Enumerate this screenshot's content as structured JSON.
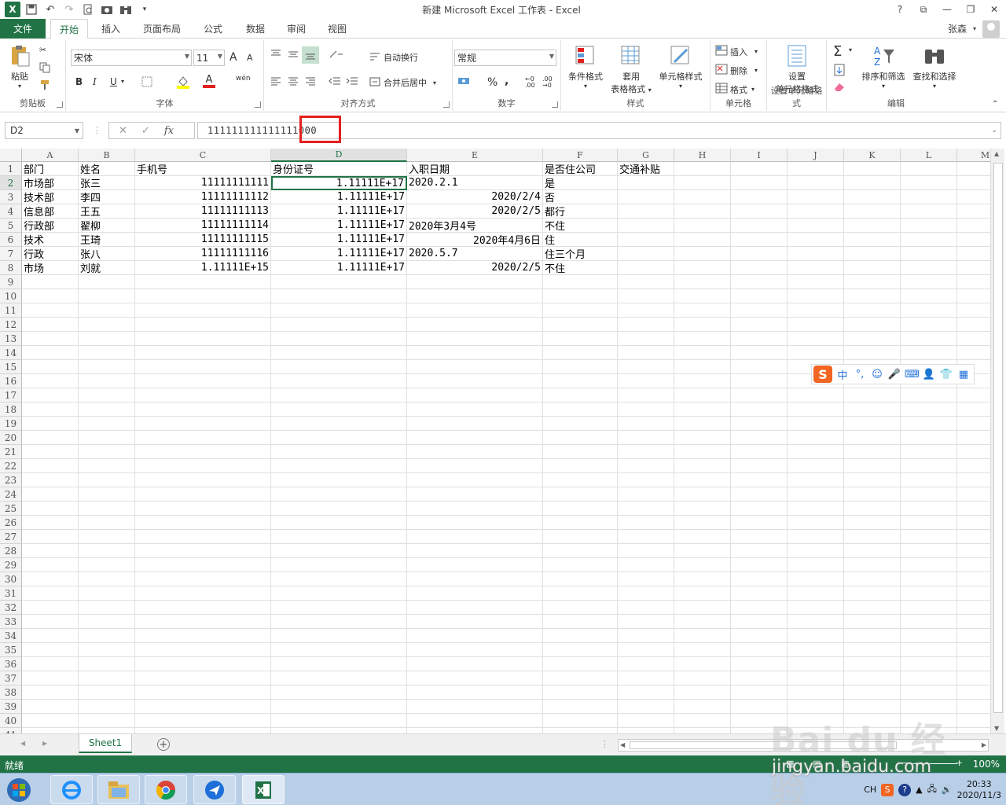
{
  "window": {
    "title": "新建 Microsoft Excel 工作表 - Excel",
    "help": "?",
    "controls": [
      "⧉",
      "—",
      "❐",
      "✕"
    ]
  },
  "tabs": {
    "file": "文件",
    "items": [
      "开始",
      "插入",
      "页面布局",
      "公式",
      "数据",
      "审阅",
      "视图"
    ],
    "active": "开始",
    "user": "张森"
  },
  "ribbon": {
    "clipboard": {
      "label": "剪贴板",
      "paste": "粘贴"
    },
    "font": {
      "label": "字体",
      "name": "宋体",
      "size": "11",
      "bold": "B",
      "italic": "I",
      "underline": "U",
      "grow": "A",
      "shrink": "A",
      "phonetic": "wén",
      "color_char": "A"
    },
    "alignment": {
      "label": "对齐方式",
      "wrap": "自动换行",
      "merge": "合并后居中"
    },
    "number": {
      "label": "数字",
      "format": "常规",
      "percent": "%",
      "comma": ","
    },
    "styles": {
      "label": "样式",
      "conditional": "条件格式",
      "table_line1": "套用",
      "table_line2": "表格格式",
      "cell_styles": "单元格样式"
    },
    "cells": {
      "label": "单元格",
      "insert": "插入",
      "delete": "删除",
      "format": "格式"
    },
    "setformat": {
      "label": "设置单元格格式",
      "line1": "设置",
      "line2": "单元格格式"
    },
    "editing": {
      "label": "编辑",
      "sum": "Σ",
      "sort": "排序和筛选",
      "find": "查找和选择"
    }
  },
  "formula_bar": {
    "name_box": "D2",
    "cancel": "✕",
    "enter": "✓",
    "fx": "fx",
    "value": "111111111111111000"
  },
  "columns": [
    "A",
    "B",
    "C",
    "D",
    "E",
    "F",
    "G",
    "H",
    "I",
    "J",
    "K",
    "L",
    "M"
  ],
  "selected_column": "D",
  "selected_row": 2,
  "rows": [
    [
      "部门",
      "姓名",
      "手机号",
      "身份证号",
      "入职日期",
      "是否住公司",
      "交通补贴"
    ],
    [
      "市场部",
      "张三",
      "11111111111",
      "1.11111E+17",
      "2020.2.1",
      "是",
      ""
    ],
    [
      "技术部",
      "李四",
      "11111111112",
      "1.11111E+17",
      "2020/2/4",
      "否",
      ""
    ],
    [
      "信息部",
      "王五",
      "11111111113",
      "1.11111E+17",
      "2020/2/5",
      "都行",
      ""
    ],
    [
      "行政部",
      "翟柳",
      "11111111114",
      "1.11111E+17",
      "2020年3月4号",
      "不住",
      ""
    ],
    [
      "技术",
      "王琦",
      "11111111115",
      "1.11111E+17",
      "2020年4月6日",
      "住",
      ""
    ],
    [
      "行政",
      "张八",
      "11111111116",
      "1.11111E+17",
      "2020.5.7",
      "住三个月",
      ""
    ],
    [
      "市场",
      "刘就",
      "1.11111E+15",
      "1.11111E+17",
      "2020/2/5",
      "不住",
      ""
    ]
  ],
  "right_aligned": [
    [
      false,
      false,
      false,
      false,
      false,
      false,
      false
    ],
    [
      false,
      false,
      true,
      true,
      false,
      false,
      false
    ],
    [
      false,
      false,
      true,
      true,
      true,
      false,
      false
    ],
    [
      false,
      false,
      true,
      true,
      true,
      false,
      false
    ],
    [
      false,
      false,
      true,
      true,
      false,
      false,
      false
    ],
    [
      false,
      false,
      true,
      true,
      true,
      false,
      false
    ],
    [
      false,
      false,
      true,
      true,
      false,
      false,
      false
    ],
    [
      false,
      false,
      true,
      true,
      true,
      false,
      false
    ]
  ],
  "visible_row_count": 41,
  "sheets": {
    "active": "Sheet1",
    "add": "+"
  },
  "status": {
    "ready": "就绪",
    "zoom": "100%"
  },
  "ime": {
    "logo": "S",
    "lang": "中",
    "punct": "°,",
    "icons": [
      "☺",
      "🎤",
      "⌨",
      "👤",
      "👕",
      "▦"
    ]
  },
  "watermark": {
    "main": "Bai du 经验",
    "sub": "jingyan.baidu.com"
  },
  "taskbar": {
    "tray_lang": "CH",
    "time": "20:33",
    "date": "2020/11/3"
  }
}
